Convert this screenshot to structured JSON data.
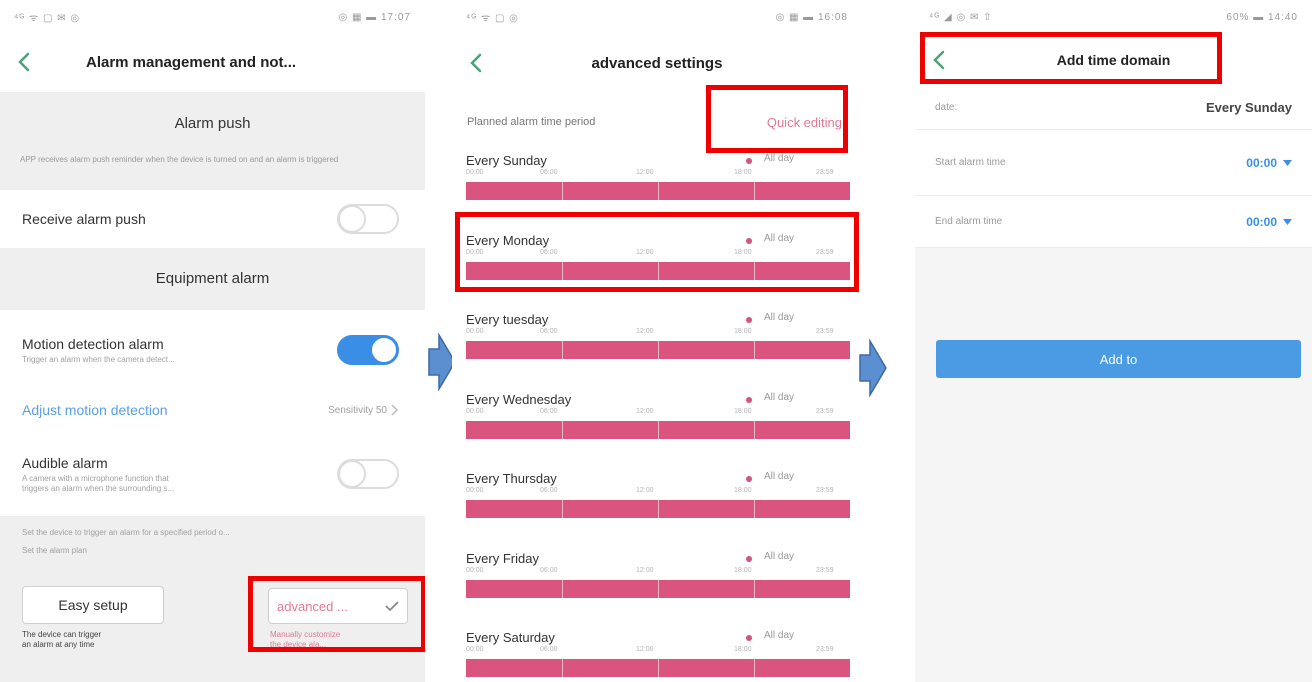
{
  "phone1": {
    "status_left": "⁴ᴳ ᯤ ▢ ✉ ◎",
    "status_right": "◎ ▦ ▬ 17:07",
    "nav_title": "Alarm management and not...",
    "alarm_push_header": "Alarm push",
    "alarm_push_desc": "APP receives alarm push reminder when the device is turned on and an alarm is triggered",
    "receive_alarm_push_label": "Receive alarm push",
    "receive_alarm_push_on": false,
    "equipment_alarm_header": "Equipment alarm",
    "motion_label": "Motion detection alarm",
    "motion_sub": "Trigger an alarm when the camera detect...",
    "motion_on": true,
    "adjust_motion_label": "Adjust motion detection",
    "sensitivity_label": "Sensitivity 50",
    "audible_label": "Audible alarm",
    "audible_sub_1": "A camera with a microphone function that",
    "audible_sub_2": "triggers an alarm when the surrounding s...",
    "audible_on": false,
    "plan_desc": "Set the device to trigger an alarm for a specified period o...",
    "plan_title": "Set the alarm plan",
    "easy_setup_label": "Easy setup",
    "easy_setup_desc_1": "The device can trigger",
    "easy_setup_desc_2": "an alarm at any time",
    "advanced_label": "advanced ...",
    "advanced_desc_1": "Manually customize",
    "advanced_desc_2": "the device ala..."
  },
  "phone2": {
    "status_left": "⁴ᴳ ᯤ ▢ ◎",
    "status_right": "◎ ▦ ▬ 16:08",
    "nav_title": "advanced settings",
    "planned_label": "Planned alarm time period",
    "quick_editing": "Quick editing",
    "all_day": "All day",
    "ticks": [
      "00:00",
      "06:00",
      "12:00",
      "18:00",
      "23:59"
    ],
    "days": [
      {
        "name": "Every Sunday"
      },
      {
        "name": "Every Monday"
      },
      {
        "name": "Every tuesday"
      },
      {
        "name": "Every Wednesday"
      },
      {
        "name": "Every Thursday"
      },
      {
        "name": "Every Friday"
      },
      {
        "name": "Every Saturday"
      }
    ]
  },
  "phone3": {
    "status_left": "⁴ᴳ ◢ ◎ ✉ ⇧",
    "status_right": "60% ▬ 14:40",
    "nav_title": "Add time domain",
    "date_label": "date:",
    "date_value": "Every Sunday",
    "start_label": "Start alarm time",
    "start_value": "00:00",
    "end_label": "End alarm time",
    "end_value": "00:00",
    "add_button": "Add to"
  },
  "colors": {
    "highlight_red": "#ee0000",
    "accent_blue": "#3a8ee6",
    "alarm_pink": "#d9547f",
    "flow_arrow_blue": "#4a86c8"
  },
  "icons": {
    "back": "chevron-left-icon",
    "chevron_right": "chevron-right-icon",
    "check": "check-icon",
    "dropdown": "caret-down-icon",
    "flow_arrow": "arrow-right-icon"
  }
}
